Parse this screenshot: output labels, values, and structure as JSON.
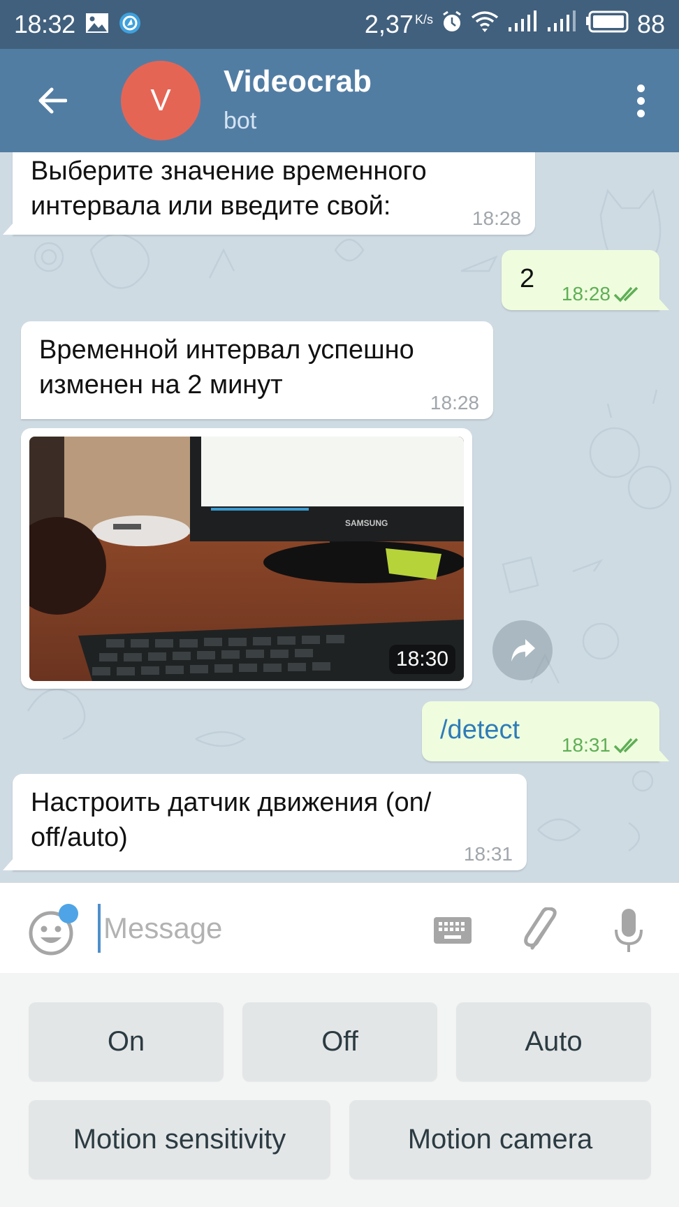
{
  "status_bar": {
    "time": "18:32",
    "net_speed": "2,37",
    "net_speed_unit": "K/s",
    "battery": "88",
    "icons": [
      "image-icon",
      "shutter-app-icon",
      "alarm-icon",
      "wifi-icon",
      "signal-icon",
      "signal-icon",
      "battery-icon"
    ]
  },
  "header": {
    "avatar_letter": "V",
    "avatar_color": "#e56555",
    "title": "Videocrab",
    "subtitle": "bot",
    "back_icon": "arrow-left-icon",
    "menu_icon": "more-vertical-icon"
  },
  "messages": [
    {
      "direction": "in",
      "text_line1": "Выберите значение временного",
      "text_line2": "интервала или введите свой:",
      "time": "18:28"
    },
    {
      "direction": "out",
      "text": "2",
      "time": "18:28",
      "status": "read"
    },
    {
      "direction": "in",
      "text_line1": "Временной интервал успешно",
      "text_line2": "изменен на 2 минут",
      "time": "18:28"
    },
    {
      "direction": "in",
      "type": "photo",
      "photo_desc": "Desk with Samsung monitor, router and keyboard",
      "time": "18:30"
    },
    {
      "direction": "out",
      "text": "/detect",
      "time": "18:31",
      "status": "read"
    },
    {
      "direction": "in",
      "text_line1": "Настроить датчик движения (on/",
      "text_line2": "off/auto)",
      "time": "18:31"
    }
  ],
  "input": {
    "placeholder": "Message",
    "value": ""
  },
  "bot_keyboard": {
    "row1": [
      "On",
      "Off",
      "Auto"
    ],
    "row2": [
      "Motion sensitivity",
      "Motion camera"
    ]
  },
  "colors": {
    "status_bar": "#41607d",
    "header": "#527da3",
    "chat_bg": "#cfdbe3",
    "out_bubble": "#effdde",
    "read_check": "#5fae56",
    "command_link": "#2e7cb8",
    "keyboard_bg": "#f3f4f4",
    "keyboard_button": "#e3e6e7"
  }
}
